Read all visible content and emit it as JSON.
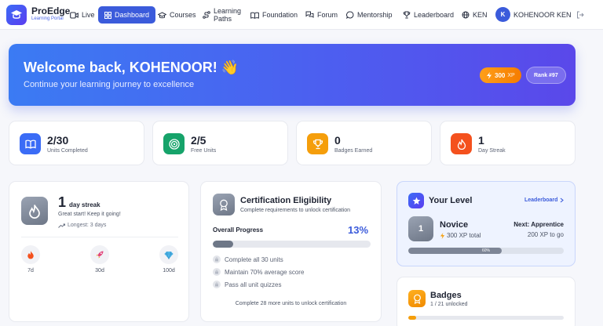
{
  "brand": {
    "name": "ProEdge",
    "subtitle": "Learning Portal"
  },
  "nav": {
    "live": "Live",
    "dashboard": "Dashboard",
    "courses": "Courses",
    "learning_paths_1": "Learning",
    "learning_paths_2": "Paths",
    "foundation": "Foundation",
    "forum": "Forum",
    "mentorship": "Mentorship",
    "leaderboard": "Leaderboard",
    "ken": "KEN",
    "avatar_initial": "K",
    "user_name": "KOHENOOR KEN"
  },
  "hero": {
    "title": "Welcome back, KOHENOOR! 👋",
    "subtitle": "Continue your learning journey to excellence",
    "xp_value": "300",
    "xp_unit": "XP",
    "rank": "Rank #97"
  },
  "stats": [
    {
      "value": "2/30",
      "label": "Units Completed",
      "color": "#3b6cf6"
    },
    {
      "value": "2/5",
      "label": "Free Units",
      "color": "#16a36a"
    },
    {
      "value": "0",
      "label": "Badges Earned",
      "color": "#f59e0b"
    },
    {
      "value": "1",
      "label": "Day Streak",
      "color": "#f4511e"
    }
  ],
  "streak": {
    "count": "1",
    "unit": "day streak",
    "message": "Great start! Keep it going!",
    "longest": "Longest: 3 days",
    "milestones": [
      "7d",
      "30d",
      "100d"
    ]
  },
  "certification": {
    "title": "Certification Eligibility",
    "subtitle": "Complete requirements to unlock certification",
    "progress_label": "Overall Progress",
    "progress_pct": "13%",
    "progress_value": 0.13,
    "requirements": [
      "Complete all 30 units",
      "Maintain 70% average score",
      "Pass all unit quizzes"
    ],
    "footer": "Complete 28 more units to unlock certification"
  },
  "level": {
    "title": "Your Level",
    "link": "Leaderboard",
    "number": "1",
    "name": "Novice",
    "xp": "300 XP total",
    "next": "Next: Apprentice",
    "to_go": "200 XP to go",
    "progress_label": "60%",
    "progress_value": 0.6
  },
  "badges": {
    "title": "Badges",
    "subtitle": "1 / 21 unlocked",
    "progress_value": 0.05
  },
  "colors": {
    "accent": "#3b5bdb",
    "xp": "#f57c00"
  }
}
